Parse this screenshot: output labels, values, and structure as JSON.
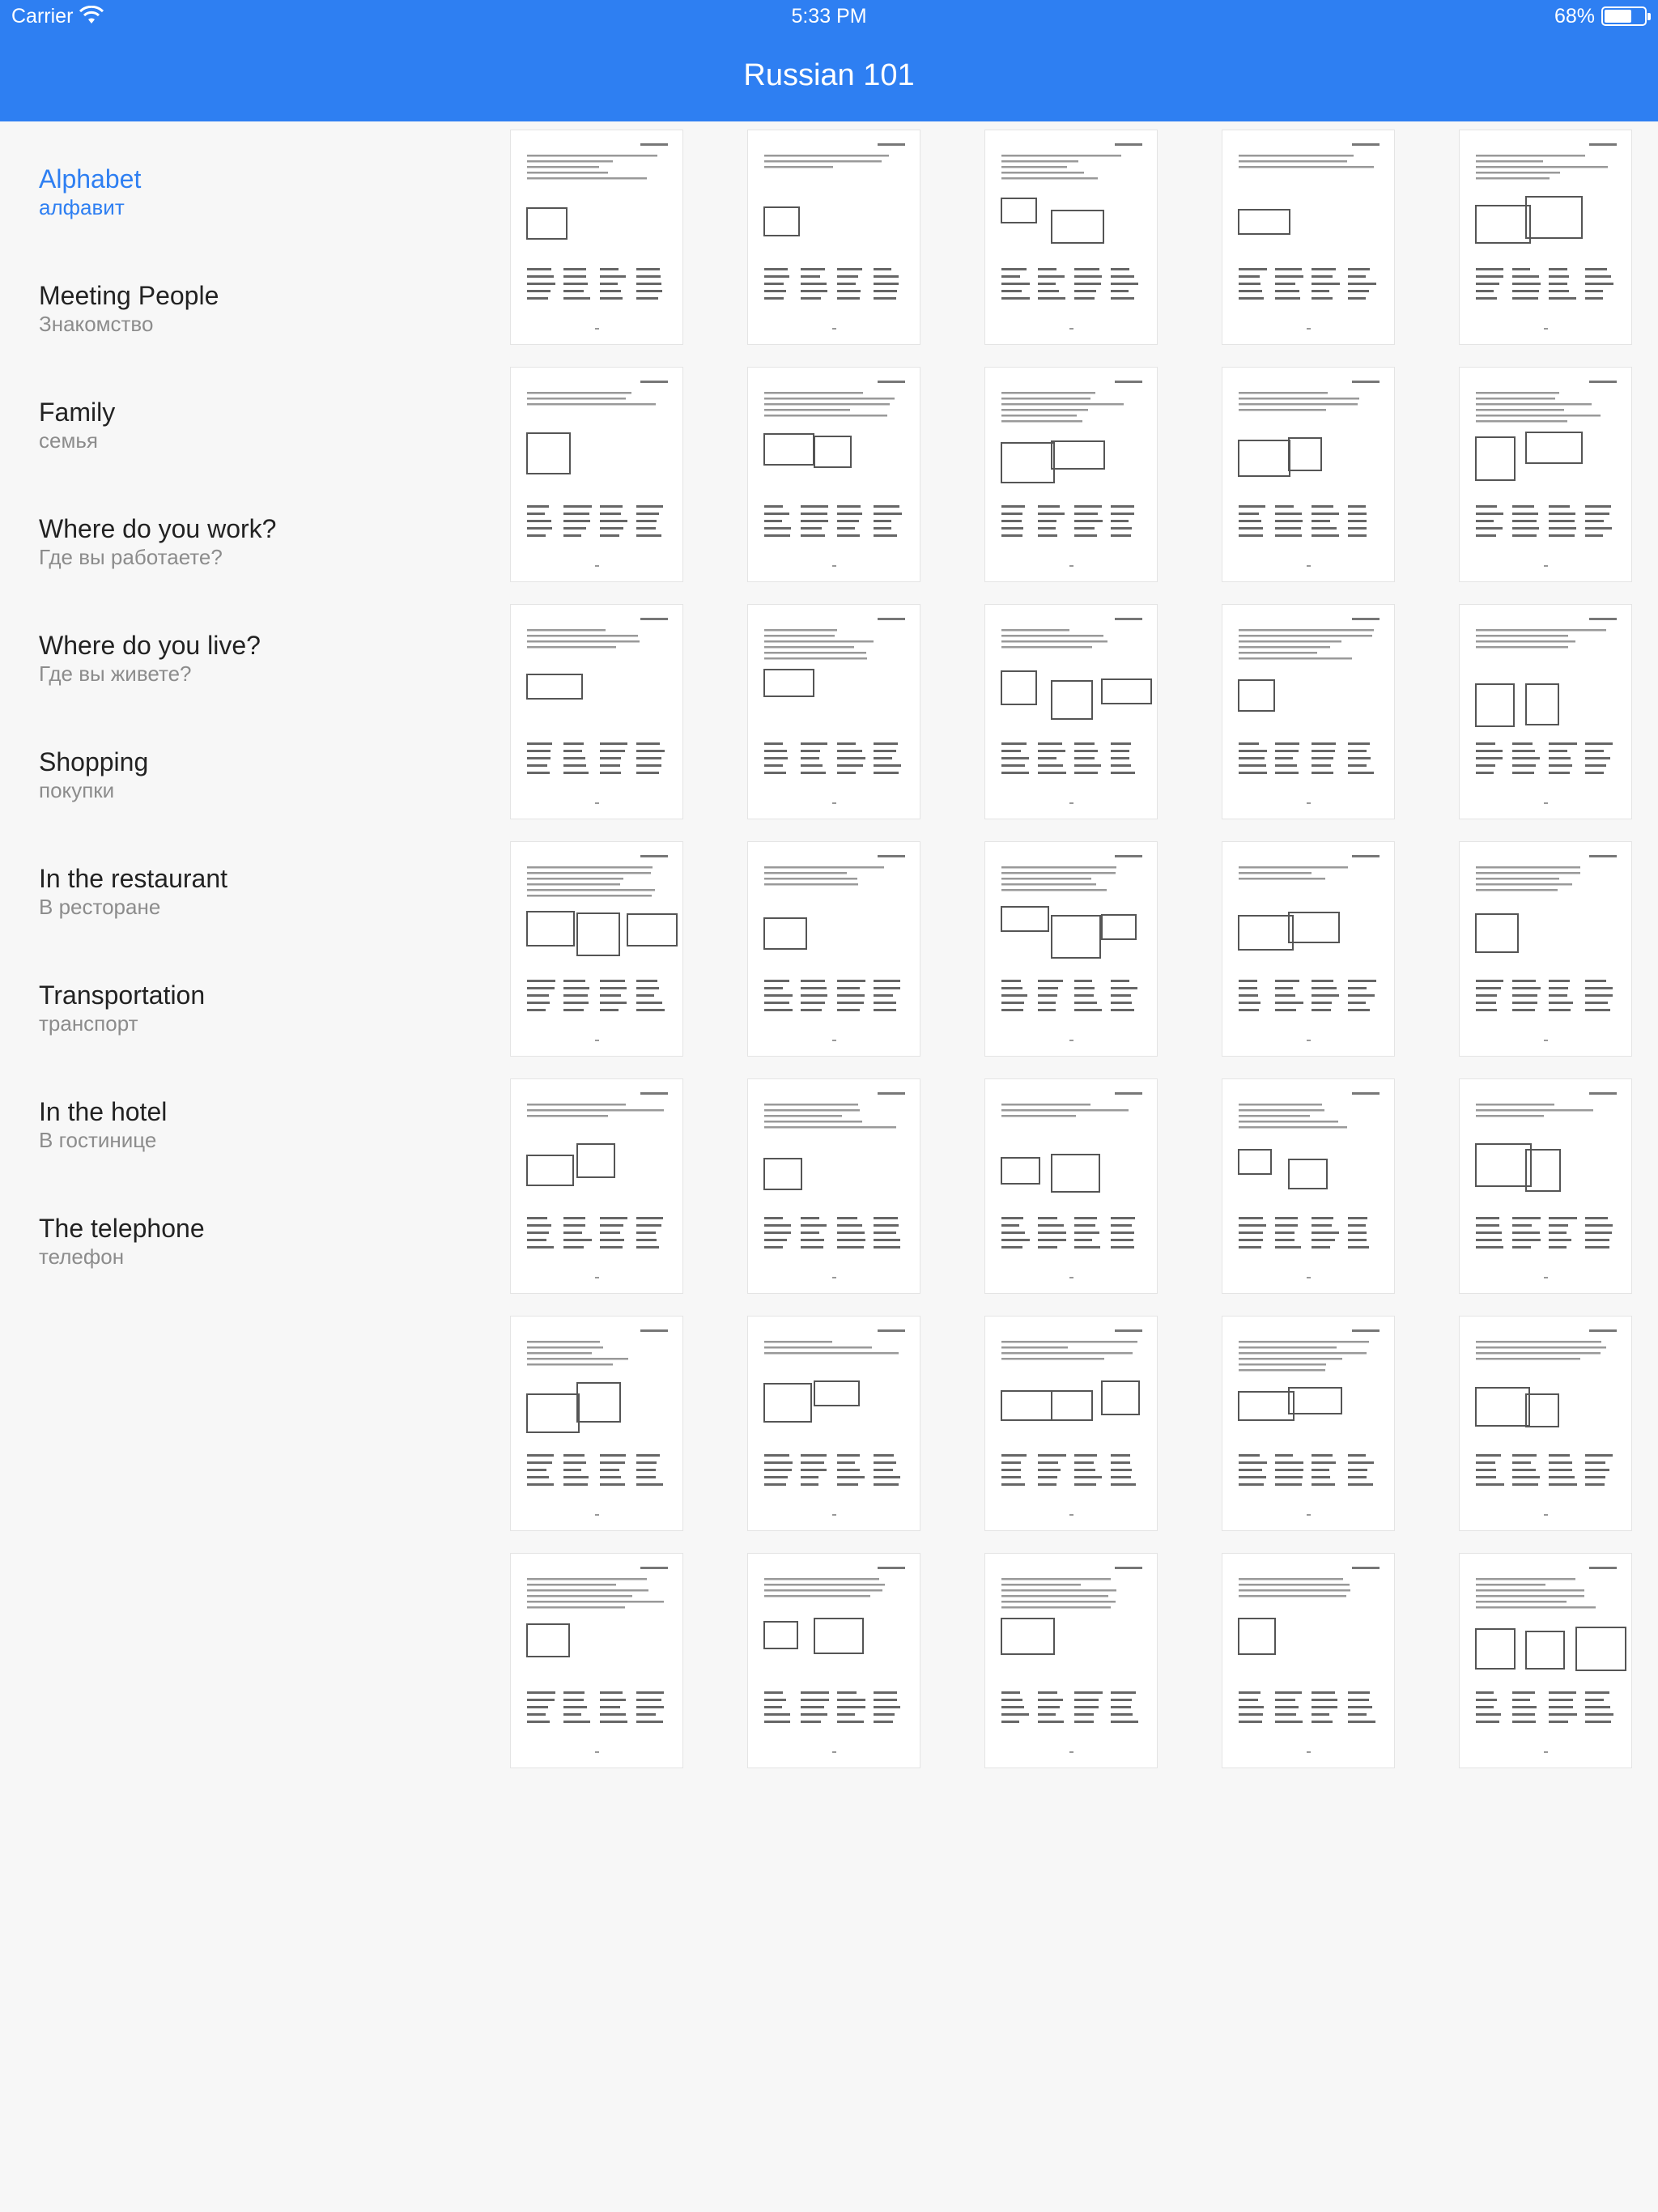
{
  "status_bar": {
    "carrier": "Carrier",
    "time": "5:33 PM",
    "battery": "68%",
    "battery_level": 0.68
  },
  "nav": {
    "title": "Russian 101"
  },
  "sidebar": {
    "items": [
      {
        "label": "Alphabet",
        "sublabel": "алфавит",
        "active": true
      },
      {
        "label": "Meeting People",
        "sublabel": "Знакомство",
        "active": false
      },
      {
        "label": "Family",
        "sublabel": "семья",
        "active": false
      },
      {
        "label": "Where do you work?",
        "sublabel": "Где вы работаете?",
        "active": false
      },
      {
        "label": "Where do you live?",
        "sublabel": "Где вы живете?",
        "active": false
      },
      {
        "label": "Shopping",
        "sublabel": "покупки",
        "active": false
      },
      {
        "label": "In the restaurant",
        "sublabel": "В ресторане",
        "active": false
      },
      {
        "label": "Transportation",
        "sublabel": "транспорт",
        "active": false
      },
      {
        "label": "In the hotel",
        "sublabel": "В гостинице",
        "active": false
      },
      {
        "label": "The telephone",
        "sublabel": "телефон",
        "active": false
      }
    ]
  },
  "worksheet_grid": {
    "rows": 7,
    "columns": 5,
    "page_count": 35
  }
}
